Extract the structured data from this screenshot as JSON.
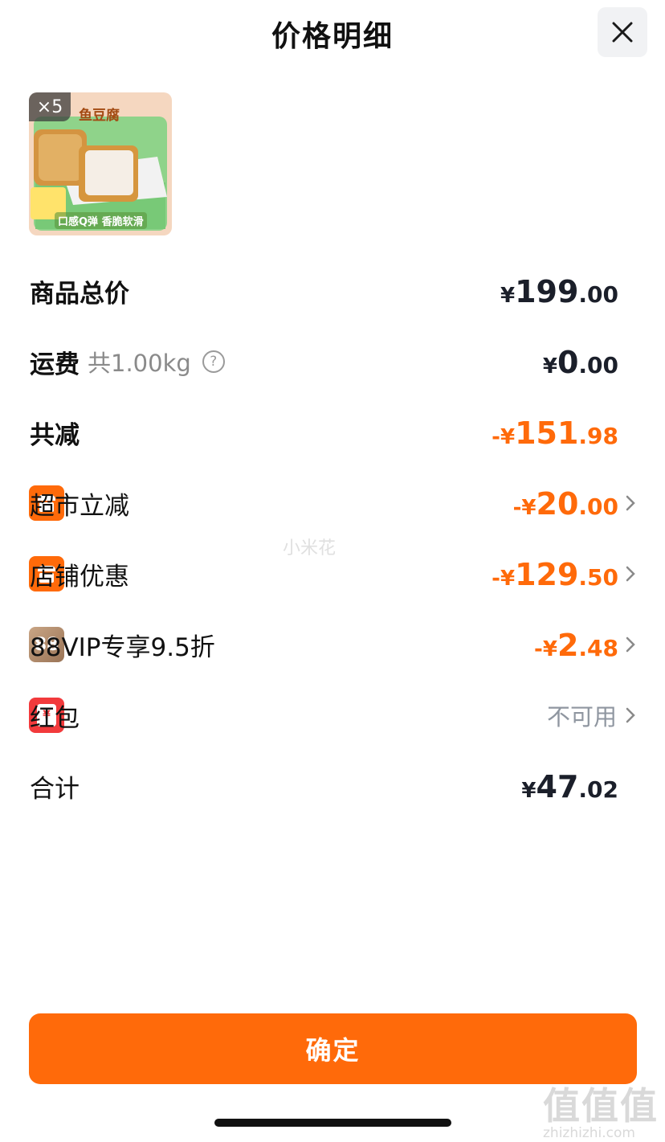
{
  "header": {
    "title": "价格明细",
    "close_icon": "close-icon"
  },
  "product": {
    "quantity_badge": "×5",
    "image_title": "鱼豆腐",
    "image_slogan": "口感Q弹 香脆软滑"
  },
  "rows": {
    "goods_total": {
      "label": "商品总价",
      "currency": "¥",
      "int": "199",
      "dec": ".00"
    },
    "shipping": {
      "label": "运费",
      "weight": "共1.00kg",
      "help_icon": "help-circle-icon",
      "currency": "¥",
      "int": "0",
      "dec": ".00"
    },
    "total_discount": {
      "label": "共减",
      "currency": "-¥",
      "int": "151",
      "dec": ".98"
    },
    "supermarket": {
      "label": "超市立减",
      "currency": "-¥",
      "int": "20",
      "dec": ".00",
      "icon": "store-icon"
    },
    "store_offer": {
      "label": "店铺优惠",
      "currency": "-¥",
      "int": "129",
      "dec": ".50",
      "icon": "store-icon"
    },
    "vip": {
      "label": "88VIP专享9.5折",
      "badge": "88",
      "currency": "-¥",
      "int": "2",
      "dec": ".48"
    },
    "red_packet": {
      "label": "红包",
      "status": "不可用",
      "icon_glyph": "¥"
    },
    "total": {
      "label": "合计",
      "currency": "¥",
      "int": "47",
      "dec": ".02"
    }
  },
  "watermark": "小米花",
  "site_logo": {
    "big": "值值值",
    "small": "zhizhizhi.com"
  },
  "footer": {
    "confirm_label": "确定"
  },
  "colors": {
    "accent": "#ff6a0a",
    "dark_amount": "#1b1f2a",
    "muted": "#8f96a0",
    "red_icon": "#f23a3c",
    "vip_icon": "#b58c6a"
  }
}
